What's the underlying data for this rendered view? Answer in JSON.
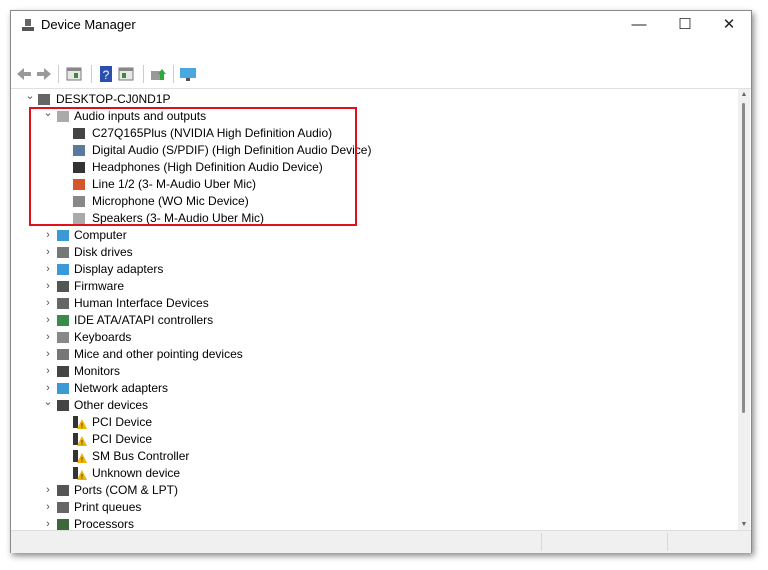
{
  "window": {
    "title": "Device Manager",
    "minimize": "—",
    "maximize": "☐",
    "close": "✕"
  },
  "toolbar": [
    "back-icon",
    "forward-icon",
    "properties-icon",
    "help-icon",
    "view-icon",
    "update-driver-icon",
    "monitor-icon"
  ],
  "highlight_color": "#e0101a",
  "tree": [
    {
      "level": 0,
      "expanded": true,
      "label": "DESKTOP-CJ0ND1P",
      "icon": "computer-icon"
    },
    {
      "level": 1,
      "expanded": true,
      "label": "Audio inputs and outputs",
      "icon": "speaker-icon"
    },
    {
      "level": 2,
      "label": "C27Q165Plus (NVIDIA High Definition Audio)",
      "icon": "monitor-icon"
    },
    {
      "level": 2,
      "label": "Digital Audio (S/PDIF) (High Definition Audio Device)",
      "icon": "digital-audio-icon"
    },
    {
      "level": 2,
      "label": "Headphones (High Definition Audio Device)",
      "icon": "headphones-icon"
    },
    {
      "level": 2,
      "label": "Line 1/2 (3- M-Audio Uber Mic)",
      "icon": "line-in-icon"
    },
    {
      "level": 2,
      "label": "Microphone (WO Mic Device)",
      "icon": "microphone-icon"
    },
    {
      "level": 2,
      "label": "Speakers (3- M-Audio Uber Mic)",
      "icon": "speaker-icon"
    },
    {
      "level": 1,
      "expanded": false,
      "label": "Computer",
      "icon": "computer-monitor-icon"
    },
    {
      "level": 1,
      "expanded": false,
      "label": "Disk drives",
      "icon": "disk-drive-icon"
    },
    {
      "level": 1,
      "expanded": false,
      "label": "Display adapters",
      "icon": "display-adapter-icon"
    },
    {
      "level": 1,
      "expanded": false,
      "label": "Firmware",
      "icon": "firmware-icon"
    },
    {
      "level": 1,
      "expanded": false,
      "label": "Human Interface Devices",
      "icon": "hid-icon"
    },
    {
      "level": 1,
      "expanded": false,
      "label": "IDE ATA/ATAPI controllers",
      "icon": "ide-controller-icon"
    },
    {
      "level": 1,
      "expanded": false,
      "label": "Keyboards",
      "icon": "keyboard-icon"
    },
    {
      "level": 1,
      "expanded": false,
      "label": "Mice and other pointing devices",
      "icon": "mouse-icon"
    },
    {
      "level": 1,
      "expanded": false,
      "label": "Monitors",
      "icon": "monitor-icon"
    },
    {
      "level": 1,
      "expanded": false,
      "label": "Network adapters",
      "icon": "network-adapter-icon"
    },
    {
      "level": 1,
      "expanded": true,
      "label": "Other devices",
      "icon": "other-devices-icon"
    },
    {
      "level": 2,
      "label": "PCI Device",
      "icon": "warning-device-icon"
    },
    {
      "level": 2,
      "label": "PCI Device",
      "icon": "warning-device-icon"
    },
    {
      "level": 2,
      "label": "SM Bus Controller",
      "icon": "warning-device-icon"
    },
    {
      "level": 2,
      "label": "Unknown device",
      "icon": "warning-device-icon"
    },
    {
      "level": 1,
      "expanded": false,
      "label": "Ports (COM & LPT)",
      "icon": "port-icon"
    },
    {
      "level": 1,
      "expanded": false,
      "label": "Print queues",
      "icon": "printer-icon"
    },
    {
      "level": 1,
      "expanded": false,
      "label": "Processors",
      "icon": "processor-icon"
    }
  ]
}
